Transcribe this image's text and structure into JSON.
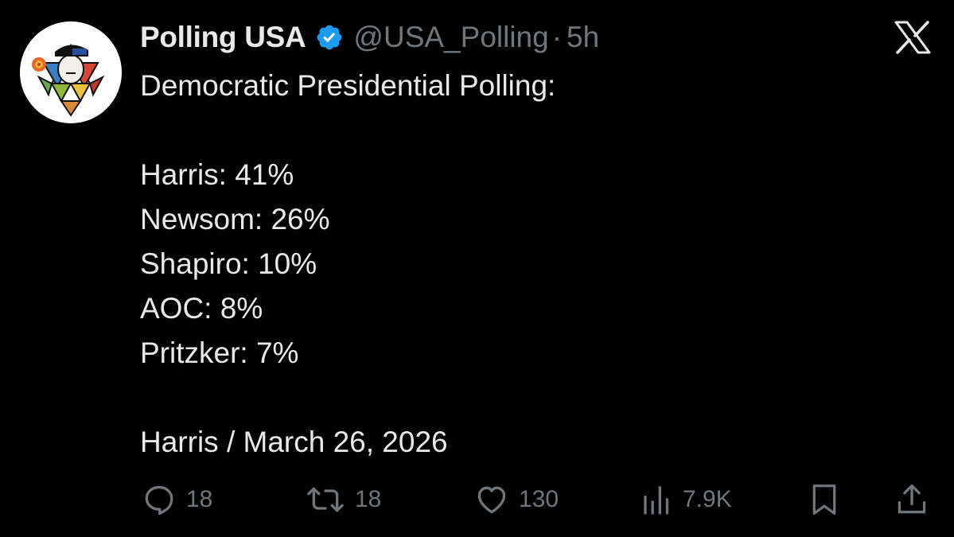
{
  "author": {
    "display_name": "Polling USA",
    "handle": "@USA_Polling",
    "separator": "·",
    "time": "5h",
    "verified_color": "#1d9bf0"
  },
  "tweet": {
    "headline": "Democratic Presidential Polling:",
    "results": [
      "Harris: 41%",
      "Newsom: 26%",
      "Shapiro: 10%",
      "AOC: 8%",
      "Pritzker: 7%"
    ],
    "footer": "Harris / March 26, 2026"
  },
  "actions": {
    "replies": "18",
    "reposts": "18",
    "likes": "130",
    "views": "7.9K"
  },
  "icons": {
    "reply": "speech-bubble-icon",
    "repost": "repost-arrows-icon",
    "like": "heart-icon",
    "views": "bar-chart-icon",
    "bookmark": "bookmark-icon",
    "share": "share-upload-icon",
    "brand": "x-logo-icon",
    "verified": "verified-badge-icon"
  },
  "colors": {
    "background": "#000000",
    "text": "#e7e9ea",
    "muted": "#71767b"
  }
}
